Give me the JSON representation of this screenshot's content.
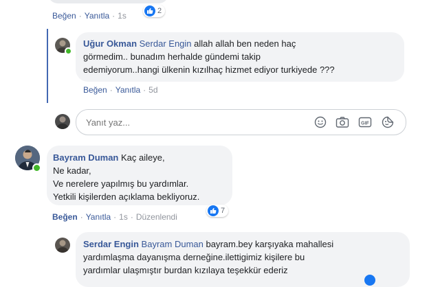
{
  "top_comment": {
    "actions": {
      "like": "Beğen",
      "reply": "Yanıtla",
      "time": "1s"
    },
    "reaction_count": "2"
  },
  "reply_ugur": {
    "author": "Uğur Okman",
    "mention": "Serdar Engin",
    "text_line1": " allah allah ben neden haç",
    "text_line2": "görmedim.. bunadım herhalde gündemi takip",
    "text_line3": "edemiyorum..hangi ülkenin kızılhaç hizmet ediyor turkiyede ???",
    "actions": {
      "like": "Beğen",
      "reply": "Yanıtla",
      "time": "5d"
    }
  },
  "reply_input": {
    "placeholder": "Yanıt yaz..."
  },
  "comment_bayram": {
    "author": "Bayram Duman",
    "line1": " Kaç aileye,",
    "line2": "Ne kadar,",
    "line3": "Ve nerelere yapılmış bu yardımlar.",
    "line4": "Yetkili kişilerden açıklama bekliyoruz.",
    "reaction_count": "7",
    "actions": {
      "like": "Beğen",
      "reply": "Yanıtla",
      "time": "1s",
      "edited": "Düzenlendi"
    }
  },
  "reply_serdar": {
    "author": "Serdar Engin",
    "mention": "Bayram Duman",
    "text_line1": " bayram.bey karşıyaka mahallesi",
    "text_line2": "yardımlaşma dayanışma derneğine.ilettigimiz kişilere bu",
    "text_line3": "yardımlar ulaşmıştır burdan kızılaya teşekkür ederiz"
  },
  "colors": {
    "link": "#385898",
    "bubble": "#f2f3f5",
    "like_blue": "#1877f2",
    "online": "#42b72a",
    "thread": "#4267b2"
  }
}
